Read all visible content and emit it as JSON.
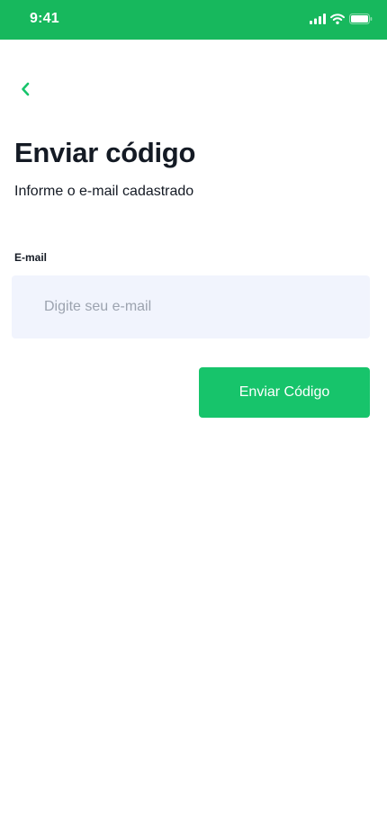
{
  "status_bar": {
    "time": "9:41",
    "background_color": "#17b85d",
    "icons": [
      "signal-icon",
      "wifi-icon",
      "battery-icon"
    ]
  },
  "header": {
    "back_icon": "chevron-left-icon",
    "accent_color": "#17c46b"
  },
  "main": {
    "title": "Enviar código",
    "subtitle": "Informe o e-mail cadastrado",
    "email": {
      "label": "E-mail",
      "value": "",
      "placeholder": "Digite seu e-mail"
    },
    "submit_label": "Enviar Código"
  }
}
